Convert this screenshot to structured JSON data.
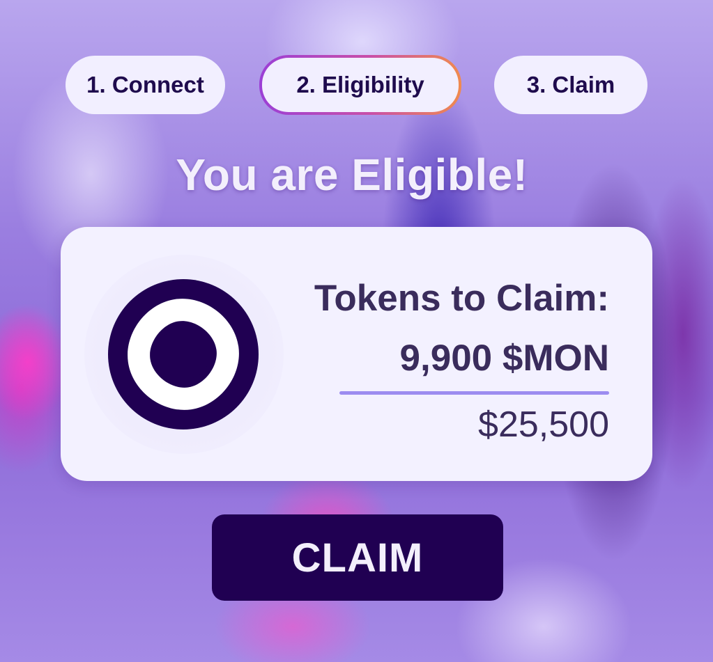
{
  "steps": [
    {
      "label": "1. Connect",
      "state": "done"
    },
    {
      "label": "2. Eligibility",
      "state": "active"
    },
    {
      "label": "3. Claim",
      "state": "upcoming"
    }
  ],
  "headline": "You are Eligible!",
  "card": {
    "logo_icon": "monad-logo-icon",
    "tokens_label": "Tokens to Claim:",
    "tokens_amount": "9,900 $MON",
    "usd_value": "$25,500"
  },
  "claim_button_label": "CLAIM",
  "colors": {
    "brand_dark": "#200052",
    "pill_bg": "#f2efff",
    "card_bg": "#f3f1ff",
    "text_dark": "#3a2c5c",
    "divider": "#9c8cf0",
    "active_border_gradient": [
      "#9b3fd6",
      "#c94fa8",
      "#f08a4e"
    ]
  }
}
